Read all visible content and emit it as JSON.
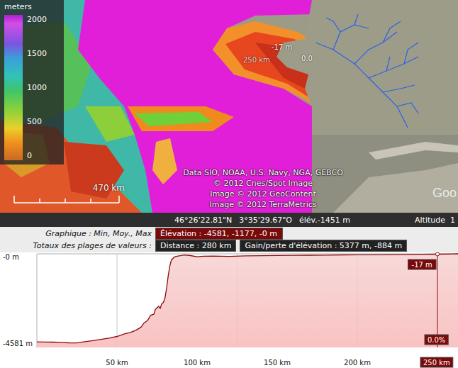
{
  "map": {
    "legend": {
      "title": "meters",
      "ticks": [
        "2000",
        "1500",
        "1000",
        "500",
        "0"
      ]
    },
    "attribution": [
      "Data SIO, NOAA, U.S. Navy, NGA, GEBCO",
      "© 2012 Cnes/Spot Image",
      "Image © 2012 GeoContent",
      "Image © 2012 TerraMetrics"
    ],
    "scale": "470  km",
    "labels": [
      {
        "text": "-17 m"
      },
      {
        "text": "250 km"
      },
      {
        "text": "0.0"
      }
    ],
    "logo": "Goo"
  },
  "status_bar": {
    "latitude": "46°26'22.81\"N",
    "longitude": "3°35'29.67\"O",
    "elevation": "élév.-1451 m",
    "altitude": "Altitude  1"
  },
  "profile": {
    "summary": [
      {
        "label": "Graphique : Min, Moy., Max",
        "values": [
          "Élévation : -4581, -1177, -0 m"
        ]
      },
      {
        "label": "Totaux des plages de valeurs :",
        "values": [
          "Distance : 280 km",
          "Gain/perte d'élévation : 5377 m, -884 m"
        ]
      }
    ],
    "y_ticks": [
      "-0 m",
      "-4581 m"
    ],
    "x_ticks": [
      "50 km",
      "100 km",
      "150 km",
      "200 km"
    ],
    "cursor": {
      "km": 250,
      "distance": "250 km",
      "elevation": "-17 m",
      "slope": "0.0%"
    },
    "series": {
      "distance_km": [
        0,
        5,
        10,
        15,
        20,
        25,
        30,
        35,
        40,
        45,
        50,
        55,
        58,
        62,
        65,
        67,
        69,
        71,
        73,
        74,
        76,
        77,
        78,
        79,
        80,
        81,
        82,
        83,
        84,
        86,
        88,
        92,
        96,
        100,
        104,
        110,
        120,
        130,
        140,
        150,
        160,
        170,
        180,
        190,
        200,
        210,
        220,
        230,
        240,
        250,
        260,
        263
      ],
      "elevation_m": [
        -4440,
        -4450,
        -4455,
        -4470,
        -4490,
        -4495,
        -4430,
        -4380,
        -4320,
        -4250,
        -4170,
        -4030,
        -3980,
        -3850,
        -3700,
        -3480,
        -3380,
        -3100,
        -3050,
        -2800,
        -2650,
        -2750,
        -2500,
        -2450,
        -2200,
        -1700,
        -1100,
        -600,
        -300,
        -150,
        -110,
        -60,
        -90,
        -150,
        -120,
        -110,
        -130,
        -100,
        -95,
        -85,
        -75,
        -70,
        -65,
        -55,
        -50,
        -45,
        -40,
        -30,
        -25,
        -17,
        -5,
        0
      ]
    }
  }
}
